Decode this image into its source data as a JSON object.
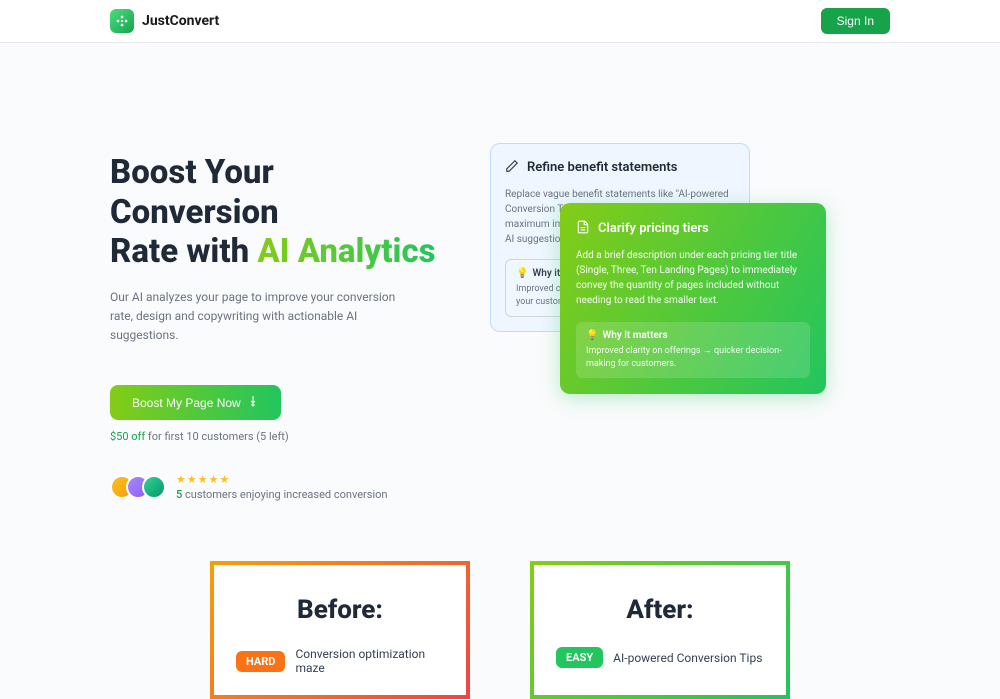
{
  "header": {
    "brand": "JustConvert",
    "signin": "Sign In"
  },
  "hero": {
    "title_line1": "Boost Your Conversion",
    "title_line2_a": "Rate with ",
    "title_line2_b": "AI Analytics",
    "subtitle": "Our AI analyzes your page to improve your conversion rate, design and copywriting with actionable AI suggestions.",
    "cta": "Boost My Page Now",
    "promo_off": "$50 off",
    "promo_rest": " for first 10 customers (5 left)"
  },
  "social": {
    "count": "5",
    "text": " customers enjoying increased conversion"
  },
  "card1": {
    "title": "Refine benefit statements",
    "body": "Replace vague benefit statements like \"AI-powered Conversion Tips\" with more specific outcomes. For maximum impact each benefit should be targeted AI suggestions.",
    "box_title": "Why it matters",
    "box_body": "Improved clarity on the actual perks you provide for your customers."
  },
  "card2": {
    "title": "Clarify pricing tiers",
    "body": "Add a brief description under each pricing tier title (Single, Three, Ten Landing Pages) to immediately convey the quantity of pages included without needing to read the smaller text.",
    "box_title": "Why it matters",
    "box_body": "Improved clarity on offerings → quicker decision-making for customers."
  },
  "compare": {
    "before": {
      "title": "Before:",
      "badge": "HARD",
      "text": "Conversion optimization maze"
    },
    "after": {
      "title": "After:",
      "badge": "EASY",
      "text": "AI-powered Conversion Tips"
    }
  }
}
